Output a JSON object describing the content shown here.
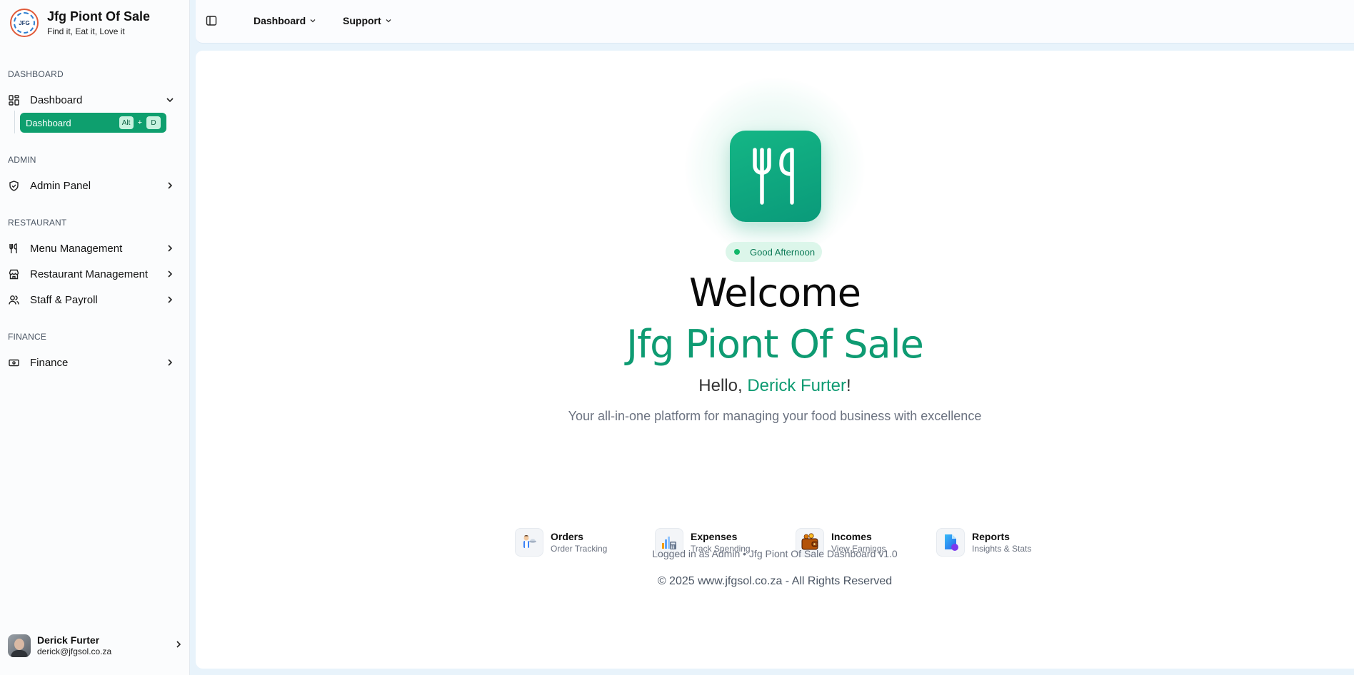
{
  "brand": {
    "title": "Jfg Piont Of Sale",
    "tagline": "Find it, Eat it, Love it",
    "logo_text": "JFG"
  },
  "sidebar": {
    "sections": {
      "dashboard": "DASHBOARD",
      "admin": "ADMIN",
      "restaurant": "RESTAURANT",
      "finance": "FINANCE"
    },
    "items": {
      "dashboard": "Dashboard",
      "admin_panel": "Admin Panel",
      "menu_management": "Menu Management",
      "restaurant_management": "Restaurant Management",
      "staff_payroll": "Staff & Payroll",
      "finance": "Finance"
    },
    "subitem": {
      "label": "Dashboard",
      "shortcut_mod": "Alt",
      "shortcut_plus": "+",
      "shortcut_key": "D"
    }
  },
  "user": {
    "name": "Derick Furter",
    "email": "derick@jfgsol.co.za"
  },
  "topbar": {
    "menu1": "Dashboard",
    "menu2": "Support"
  },
  "hero": {
    "greeting": "Good Afternoon",
    "welcome": "Welcome",
    "app_name": "Jfg Piont Of Sale",
    "hello_prefix": "Hello, ",
    "hello_name": "Derick Furter",
    "hello_suffix": "!",
    "tagline": "Your all-in-one platform for managing your food business with excellence"
  },
  "features": [
    {
      "name": "Orders",
      "sub": "Order Tracking",
      "icon": "waiter-icon"
    },
    {
      "name": "Expenses",
      "sub": "Track Spending",
      "icon": "expenses-chart-icon"
    },
    {
      "name": "Incomes",
      "sub": "View Earnings",
      "icon": "wallet-icon"
    },
    {
      "name": "Reports",
      "sub": "Insights & Stats",
      "icon": "report-icon"
    }
  ],
  "footer": {
    "status": "Logged in as Admin • Jfg Piont Of Sale Dashboard v1.0",
    "copyright": "© 2025 www.jfgsol.co.za - All Rights Reserved"
  },
  "colors": {
    "accent": "#0e9b72",
    "active_item": "#0e9f6e",
    "page_bg": "#e8f3fb"
  }
}
